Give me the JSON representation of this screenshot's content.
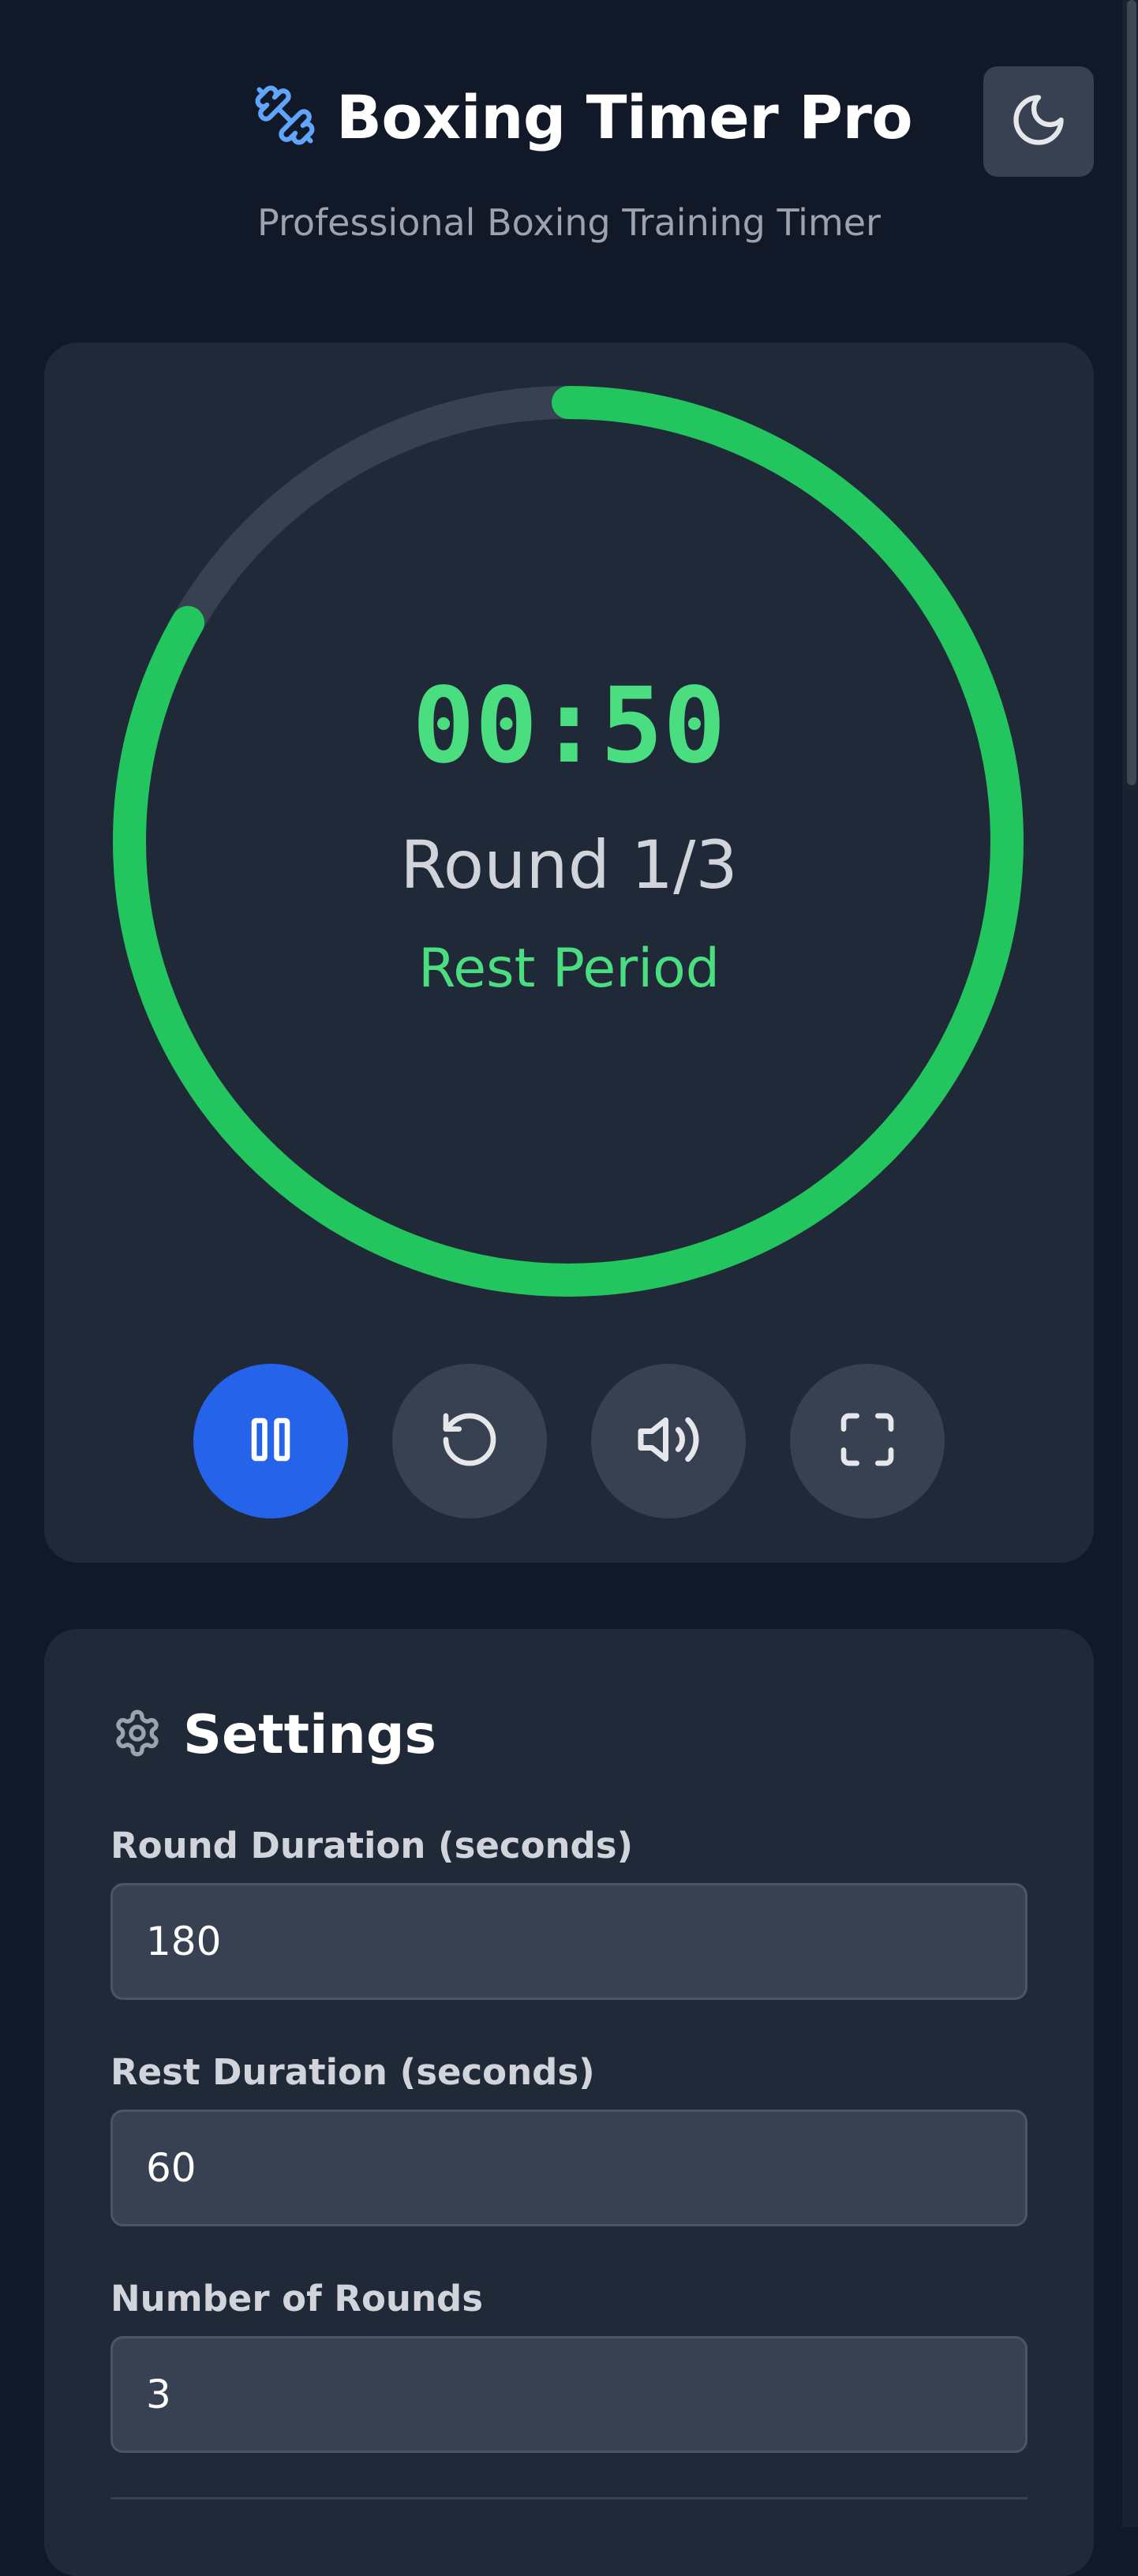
{
  "header": {
    "title": "Boxing Timer Pro",
    "subtitle": "Professional Boxing Training Timer",
    "logo_icon": "dumbbell-icon",
    "theme_icon": "moon-icon"
  },
  "timer": {
    "time": "00:50",
    "round": "Round 1/3",
    "phase": "Rest Period",
    "progress_fraction": 0.833,
    "progress_color": "#22c55e",
    "track_color": "#374151"
  },
  "controls": {
    "pause_icon": "pause-icon",
    "reset_icon": "reset-icon",
    "sound_icon": "volume-icon",
    "fullscreen_icon": "fullscreen-icon"
  },
  "settings": {
    "title": "Settings",
    "icon": "gear-icon",
    "round_duration_label": "Round Duration (seconds)",
    "round_duration_value": "180",
    "rest_duration_label": "Rest Duration (seconds)",
    "rest_duration_value": "60",
    "rounds_label": "Number of Rounds",
    "rounds_value": "3"
  },
  "colors": {
    "background": "#111827",
    "card": "#1f2937",
    "accent_green": "#4ade80",
    "accent_blue": "#2563eb"
  }
}
